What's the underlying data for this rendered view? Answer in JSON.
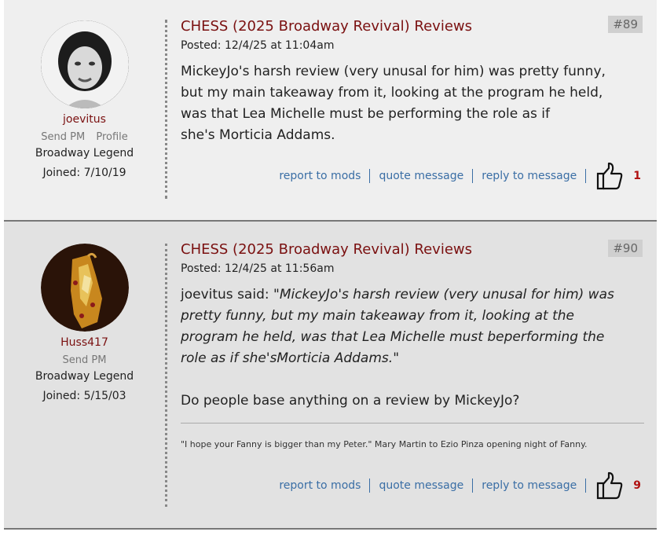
{
  "posts": [
    {
      "number": "#89",
      "username": "joevitus",
      "send_pm": "Send PM",
      "profile": "Profile",
      "rank": "Broadway Legend",
      "joined": "Joined: 7/10/19",
      "title": "CHESS (2025 Broadway Revival) Reviews",
      "posted": "Posted: 12/4/25 at 11:04am",
      "body_lines": [
        "MickeyJo's harsh review (very unusal for him) was pretty funny,",
        "but my main takeaway from it, looking at the program he held,",
        "was that Lea Michelle must be performing the role as if",
        "she's Morticia Addams."
      ],
      "actions": {
        "report": "report to mods",
        "quote": "quote message",
        "reply": "reply to message"
      },
      "likes": "1"
    },
    {
      "number": "#90",
      "username": "Huss417",
      "send_pm": "Send PM",
      "rank": "Broadway Legend",
      "joined": "Joined: 5/15/03",
      "title": "CHESS (2025 Broadway Revival) Reviews",
      "posted": "Posted: 12/4/25 at 11:56am",
      "quote_prefix": "joevitus said: \"",
      "quote_lines": [
        "MickeyJo's harsh review (very unusal for him) was",
        "pretty funny, but my main takeaway from it, looking at the",
        "program he held, was that Lea Michelle must beperforming the",
        "role as if she'sMorticia Addams."
      ],
      "quote_suffix": "\"",
      "reply_text": "Do people base anything on a review by MickeyJo?",
      "signature": "\"I hope your Fanny is bigger than my Peter.\" Mary Martin to Ezio Pinza opening night of Fanny.",
      "actions": {
        "report": "report to mods",
        "quote": "quote message",
        "reply": "reply to message"
      },
      "likes": "9"
    }
  ],
  "colors": {
    "title": "#7a1010",
    "link": "#3a6ea5",
    "likes": "#b01010"
  },
  "icons": {
    "like": "thumbs-up-icon"
  }
}
